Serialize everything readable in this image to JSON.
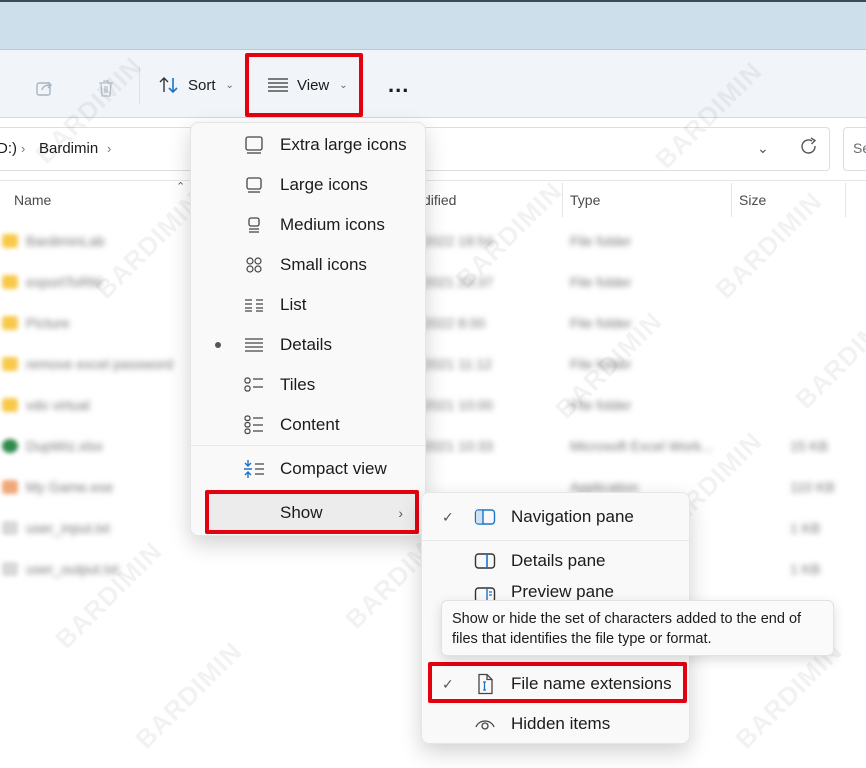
{
  "toolbar": {
    "share_icon": "share-icon",
    "delete_icon": "trash-icon",
    "sort_label": "Sort",
    "view_label": "View",
    "more_label": "..."
  },
  "address": {
    "drive_fragment": "D:)",
    "crumbs": [
      "Bardimin"
    ],
    "search_placeholder": "Se"
  },
  "columns": {
    "name": "Name",
    "modified": "dified",
    "type": "Type",
    "size": "Size"
  },
  "files": [
    {
      "name": "BardiminLab",
      "modified": "2022 18:54",
      "type": "File folder",
      "size": "",
      "icon": "folder"
    },
    {
      "name": "exportToRM",
      "modified": "2021 23:37",
      "type": "File folder",
      "size": "",
      "icon": "folder"
    },
    {
      "name": "Picture",
      "modified": "2022 8:00",
      "type": "File folder",
      "size": "",
      "icon": "folder"
    },
    {
      "name": "remove excel password",
      "modified": "2021 11:12",
      "type": "File folder",
      "size": "",
      "icon": "folder"
    },
    {
      "name": "vdo virtual",
      "modified": "2021 10:00",
      "type": "File folder",
      "size": "",
      "icon": "folder"
    },
    {
      "name": "DupWiz.xlsx",
      "modified": "2021 10:33",
      "type": "Microsoft Excel Work...",
      "size": "15 KB",
      "icon": "excel"
    },
    {
      "name": "My Game.exe",
      "modified": "",
      "type": "Application",
      "size": "110 KB",
      "icon": "app"
    },
    {
      "name": "user_input.txt",
      "modified": "",
      "type": "",
      "size": "1 KB",
      "icon": "text"
    },
    {
      "name": "user_output.txt",
      "modified": "",
      "type": "",
      "size": "1 KB",
      "icon": "text"
    }
  ],
  "view_menu": {
    "items": [
      {
        "label": "Extra large icons",
        "icon": "extra-large-icons-icon",
        "selected": false
      },
      {
        "label": "Large icons",
        "icon": "large-icons-icon",
        "selected": false
      },
      {
        "label": "Medium icons",
        "icon": "medium-icons-icon",
        "selected": false
      },
      {
        "label": "Small icons",
        "icon": "small-icons-icon",
        "selected": false
      },
      {
        "label": "List",
        "icon": "list-icon",
        "selected": false
      },
      {
        "label": "Details",
        "icon": "details-icon",
        "selected": true
      },
      {
        "label": "Tiles",
        "icon": "tiles-icon",
        "selected": false
      },
      {
        "label": "Content",
        "icon": "content-icon",
        "selected": false
      }
    ],
    "compact_view": "Compact view",
    "show": "Show"
  },
  "show_menu": {
    "items": [
      {
        "label": "Navigation pane",
        "checked": true
      },
      {
        "label": "Details pane",
        "checked": false
      },
      {
        "label": "Preview pane",
        "checked": false
      },
      {
        "label": "File name extensions",
        "checked": true
      },
      {
        "label": "Hidden items",
        "checked": false
      }
    ]
  },
  "tooltip": "Show or hide the set of characters added to the end of files that identifies the file type or format.",
  "watermark": "BARDIMIN",
  "colors": {
    "highlight": "#e3000f",
    "accent": "#0067c0",
    "folder": "#f8c94a"
  }
}
